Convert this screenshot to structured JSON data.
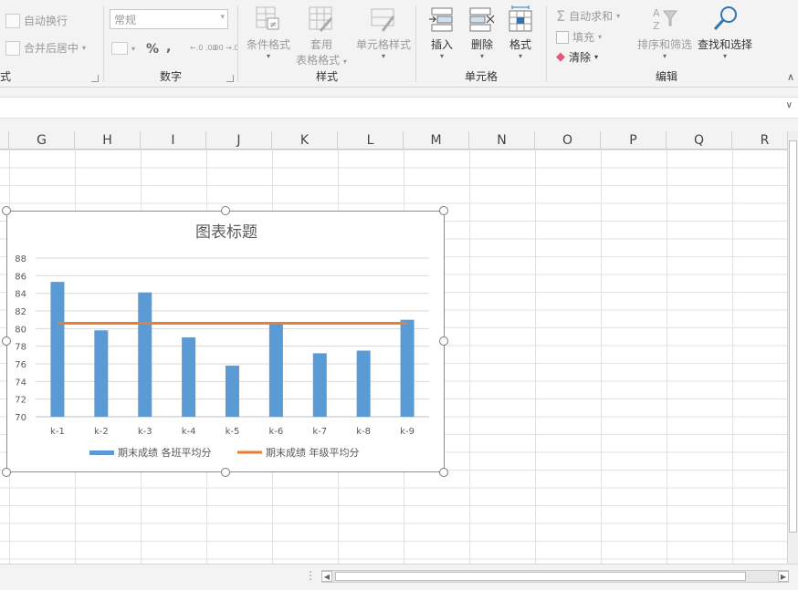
{
  "ribbon": {
    "alignment": {
      "wrap_text": "自动换行",
      "merge_center": "合并后居中",
      "partial_label": "式"
    },
    "number": {
      "format_value": "常规",
      "percent": "%",
      "comma": ",",
      "inc_decimal": "←.0 .00",
      "dec_decimal": ".00 →.0",
      "label": "数字"
    },
    "styles": {
      "conditional": "条件格式",
      "table_line1": "套用",
      "table_line2": "表格格式",
      "cell_styles": "单元格样式",
      "label": "样式"
    },
    "cells": {
      "insert": "插入",
      "delete": "删除",
      "format": "格式",
      "label": "单元格"
    },
    "editing": {
      "autosum": "自动求和",
      "fill": "填充",
      "clear": "清除",
      "sort_filter": "排序和筛选",
      "find_select": "查找和选择",
      "label": "编辑"
    }
  },
  "columns": [
    "G",
    "H",
    "I",
    "J",
    "K",
    "L",
    "M",
    "N",
    "O",
    "P",
    "Q",
    "R"
  ],
  "chart_data": {
    "type": "bar",
    "title": "图表标题",
    "categories": [
      "k-1",
      "k-2",
      "k-3",
      "k-4",
      "k-5",
      "k-6",
      "k-7",
      "k-8",
      "k-9"
    ],
    "series": [
      {
        "name": "期末成绩 各班平均分",
        "kind": "bar",
        "color": "#5b9bd5",
        "values": [
          85.3,
          79.8,
          84.1,
          79.0,
          75.8,
          80.6,
          77.2,
          77.5,
          81.0
        ]
      },
      {
        "name": "期末成绩 年级平均分",
        "kind": "line",
        "color": "#ed7d31",
        "values": [
          80.6,
          80.6,
          80.6,
          80.6,
          80.6,
          80.6,
          80.6,
          80.6,
          80.6
        ]
      }
    ],
    "ylim": [
      70,
      88
    ],
    "yticks": [
      70,
      72,
      74,
      76,
      78,
      80,
      82,
      84,
      86,
      88
    ],
    "grid": true,
    "legend": "bottom"
  }
}
